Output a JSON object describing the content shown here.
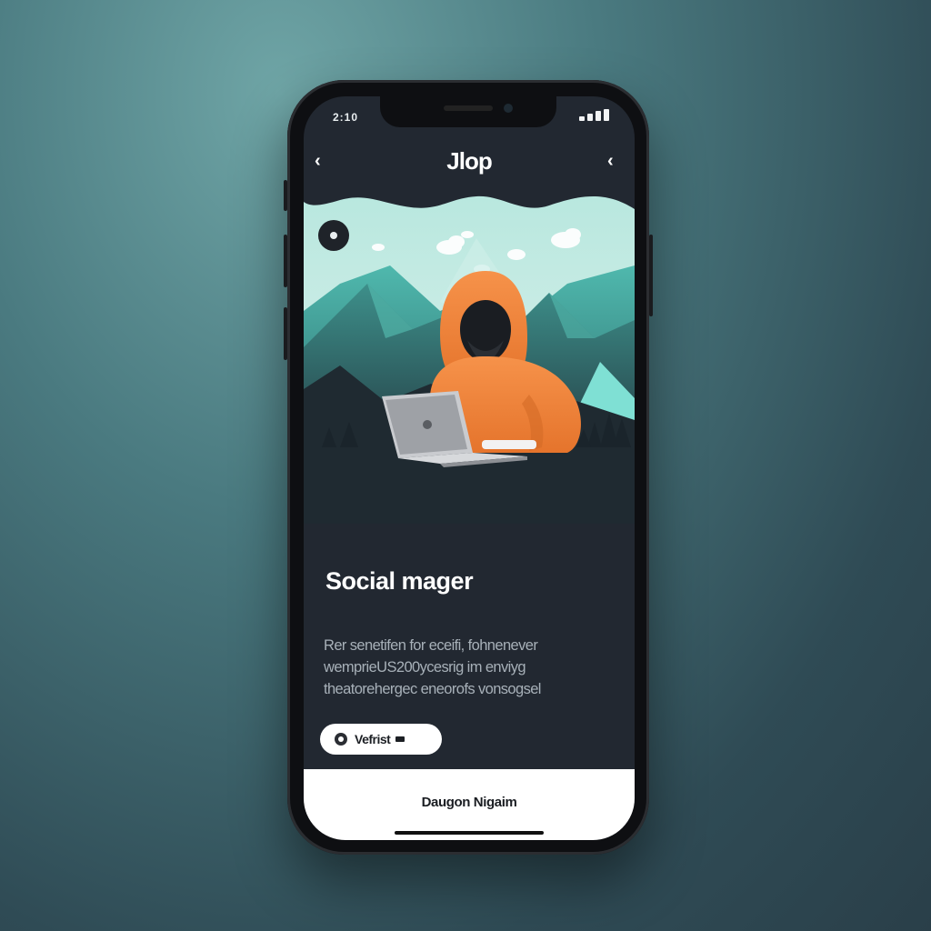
{
  "status_bar": {
    "time": "2:10"
  },
  "header": {
    "title": "Jlop",
    "back_icon": "chevron-left-icon",
    "forward_icon": "chevron-right-icon"
  },
  "hero": {
    "illustration": "hooded-person-with-laptop-mountains",
    "play_icon": "record-dot-icon"
  },
  "content": {
    "title": "Social mager",
    "description": "Rer senetifen for eceifi, fohnenever wemprieUS200ycesrig im enviyg theatorehergec eneorofs vonsogsel",
    "pill": {
      "label": "Vefrist",
      "icon": "record-dot-icon"
    }
  },
  "bottom_bar": {
    "label": "Daugon Nigaim"
  },
  "colors": {
    "accent": "#f0873a",
    "mint": "#6fd0c4",
    "screen_bg": "#222831"
  }
}
